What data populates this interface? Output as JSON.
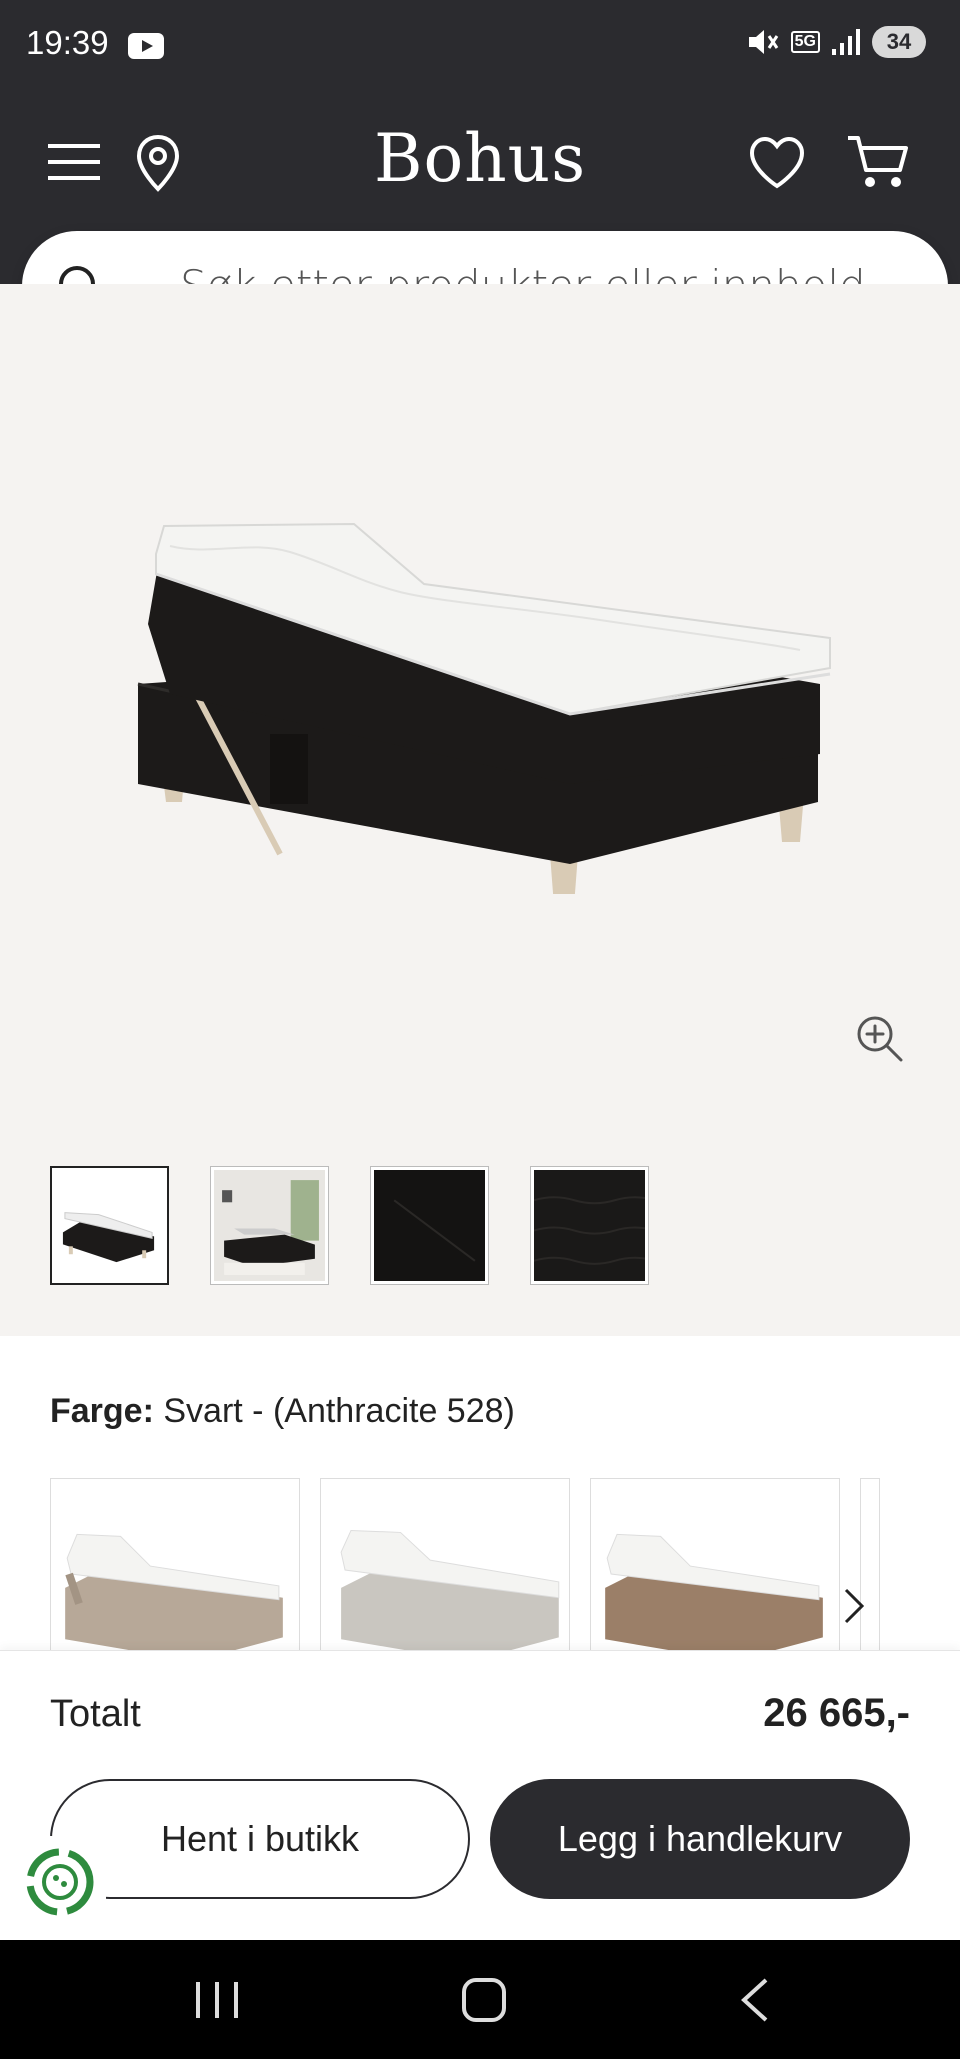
{
  "status_bar": {
    "time": "19:39",
    "battery": "34",
    "network": "5G"
  },
  "header": {
    "logo": "Bohus",
    "icons": [
      "menu-icon",
      "location-icon",
      "heart-icon",
      "cart-icon"
    ]
  },
  "search": {
    "placeholder": "Søk etter produkter eller innhold ..."
  },
  "gallery": {
    "thumbnails": [
      "bed-product",
      "bedroom-scene",
      "fabric-closeup",
      "fabric-texture"
    ],
    "active_index": 0
  },
  "color": {
    "label": "Farge:",
    "value": "Svart - (Anthracite 528)",
    "swatches": [
      {
        "name": "beige",
        "color": "#b7a898"
      },
      {
        "name": "light-grey",
        "color": "#c9c6c0"
      },
      {
        "name": "brown",
        "color": "#9b7f68"
      }
    ]
  },
  "checkout": {
    "total_label": "Totalt",
    "total_value": "26 665,-",
    "pickup_label": "Hent i butikk",
    "cart_label": "Legg i handlekurv"
  },
  "colors": {
    "dark": "#2b2b2f",
    "background": "#f5f3f1",
    "bed_fabric": "#1c1a19",
    "legs": "#d9cbb5"
  }
}
